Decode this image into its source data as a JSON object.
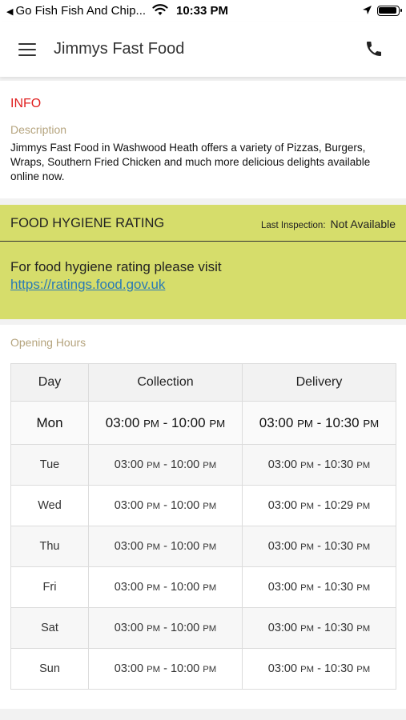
{
  "status_bar": {
    "back_app": "Go Fish Fish And Chip...",
    "time": "10:33 PM"
  },
  "header": {
    "title": "Jimmys Fast Food",
    "menu_icon": "hamburger-menu-icon",
    "phone_icon": "phone-icon"
  },
  "info": {
    "title": "INFO",
    "description_label": "Description",
    "description": "Jimmys Fast Food in Washwood Heath offers a variety of Pizzas, Burgers, Wraps, Southern  Fried Chicken and much more delicious delights available online now."
  },
  "hygiene": {
    "title": "FOOD HYGIENE RATING",
    "last_inspection_label": "Last Inspection:",
    "last_inspection_value": "Not Available",
    "message": "For food hygiene rating please visit",
    "link": "https://ratings.food.gov.uk",
    "background_color": "#d6dd6b",
    "link_color": "#2a7ab5"
  },
  "hours": {
    "label": "Opening Hours",
    "columns": [
      "Day",
      "Collection",
      "Delivery"
    ],
    "rows": [
      {
        "day": "Mon",
        "col_start": "03:00",
        "col_end": "10:00",
        "del_start": "03:00",
        "del_end": "10:30"
      },
      {
        "day": "Tue",
        "col_start": "03:00",
        "col_end": "10:00",
        "del_start": "03:00",
        "del_end": "10:30"
      },
      {
        "day": "Wed",
        "col_start": "03:00",
        "col_end": "10:00",
        "del_start": "03:00",
        "del_end": "10:29"
      },
      {
        "day": "Thu",
        "col_start": "03:00",
        "col_end": "10:00",
        "del_start": "03:00",
        "del_end": "10:30"
      },
      {
        "day": "Fri",
        "col_start": "03:00",
        "col_end": "10:00",
        "del_start": "03:00",
        "del_end": "10:30"
      },
      {
        "day": "Sat",
        "col_start": "03:00",
        "col_end": "10:00",
        "del_start": "03:00",
        "del_end": "10:30"
      },
      {
        "day": "Sun",
        "col_start": "03:00",
        "col_end": "10:00",
        "del_start": "03:00",
        "del_end": "10:30"
      }
    ],
    "pm_label": "PM"
  },
  "colors": {
    "info_title": "#e02020",
    "label": "#b5a47e"
  }
}
